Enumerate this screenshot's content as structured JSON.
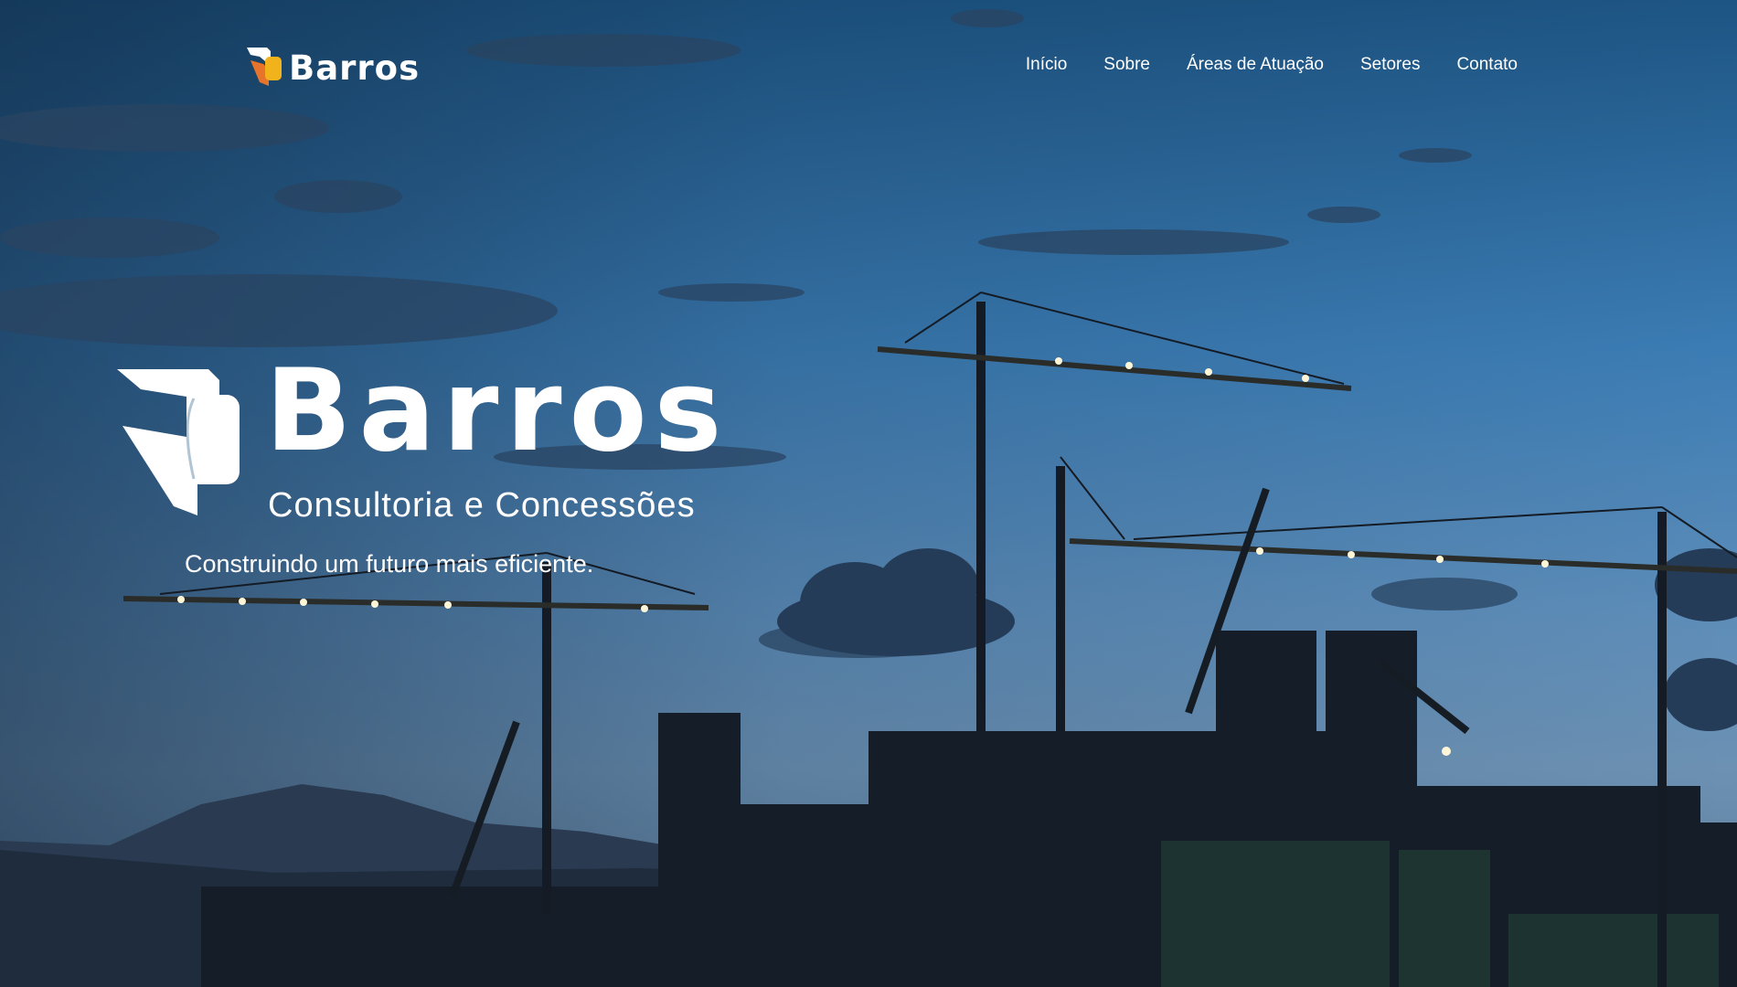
{
  "header": {
    "logo_text": "Barros",
    "nav": [
      {
        "label": "Início"
      },
      {
        "label": "Sobre"
      },
      {
        "label": "Áreas de Atuação"
      },
      {
        "label": "Setores"
      },
      {
        "label": "Contato"
      }
    ]
  },
  "hero": {
    "brand_name": "Barros",
    "subtitle": "Consultoria e Concessões",
    "tagline": "Construindo um futuro mais eficiente."
  },
  "colors": {
    "accent_orange": "#e8732a",
    "accent_yellow": "#f2b21b",
    "sky_top": "#1f5a8c",
    "sky_mid": "#3f7fb5",
    "text": "#ffffff"
  },
  "icons": {
    "header_logo": "barros-logo-icon",
    "hero_logo": "barros-logo-mark-icon"
  }
}
